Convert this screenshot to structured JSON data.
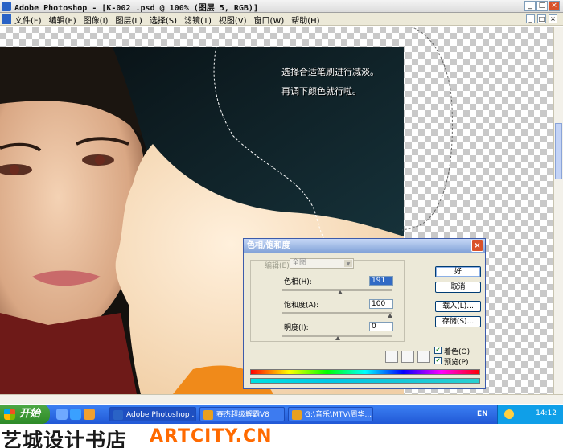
{
  "window": {
    "title": "Adobe Photoshop - [K-002 .psd @ 100% (图层 5, RGB)]",
    "buttons": [
      "_",
      "□",
      "×"
    ]
  },
  "menu": {
    "items": [
      "文件(F)",
      "编辑(E)",
      "图像(I)",
      "图层(L)",
      "选择(S)",
      "滤镜(T)",
      "视图(V)",
      "窗口(W)",
      "帮助(H)"
    ],
    "mdi_buttons": [
      "_",
      "□",
      "×"
    ]
  },
  "canvas": {
    "caption_line1": "选择合适笔刷进行减淡。",
    "caption_line2": "再调下颜色就行啦。"
  },
  "dialog": {
    "title": "色相/饱和度",
    "edit_label": "编辑(E):",
    "edit_value": "全图",
    "hue_label": "色相(H):",
    "hue_value": "191",
    "hue_level": 0.53,
    "saturation_label": "饱和度(A):",
    "saturation_value": "100",
    "saturation_level": 1.0,
    "lightness_label": "明度(I):",
    "lightness_value": "0",
    "lightness_level": 0.5,
    "ok_label": "好",
    "cancel_label": "取消",
    "load_label": "载入(L)...",
    "save_label": "存储(S)...",
    "colorize_label": "着色(O)",
    "colorize_checked": true,
    "preview_label": "预览(P)",
    "preview_checked": true
  },
  "taskbar": {
    "start_label": "开始",
    "tasks": [
      {
        "label": "Adobe Photoshop ...",
        "color": "#2a63c6"
      },
      {
        "label": "赛杰超级解霸V8",
        "color": "#e8a020"
      },
      {
        "label": "G:\\音乐\\MTV\\周华...",
        "color": "#e8a020"
      }
    ],
    "language": "EN",
    "clock": "14:12"
  },
  "footer": {
    "brand_cn": "艺城设计书店",
    "brand_en": "ARTCITY.CN"
  }
}
